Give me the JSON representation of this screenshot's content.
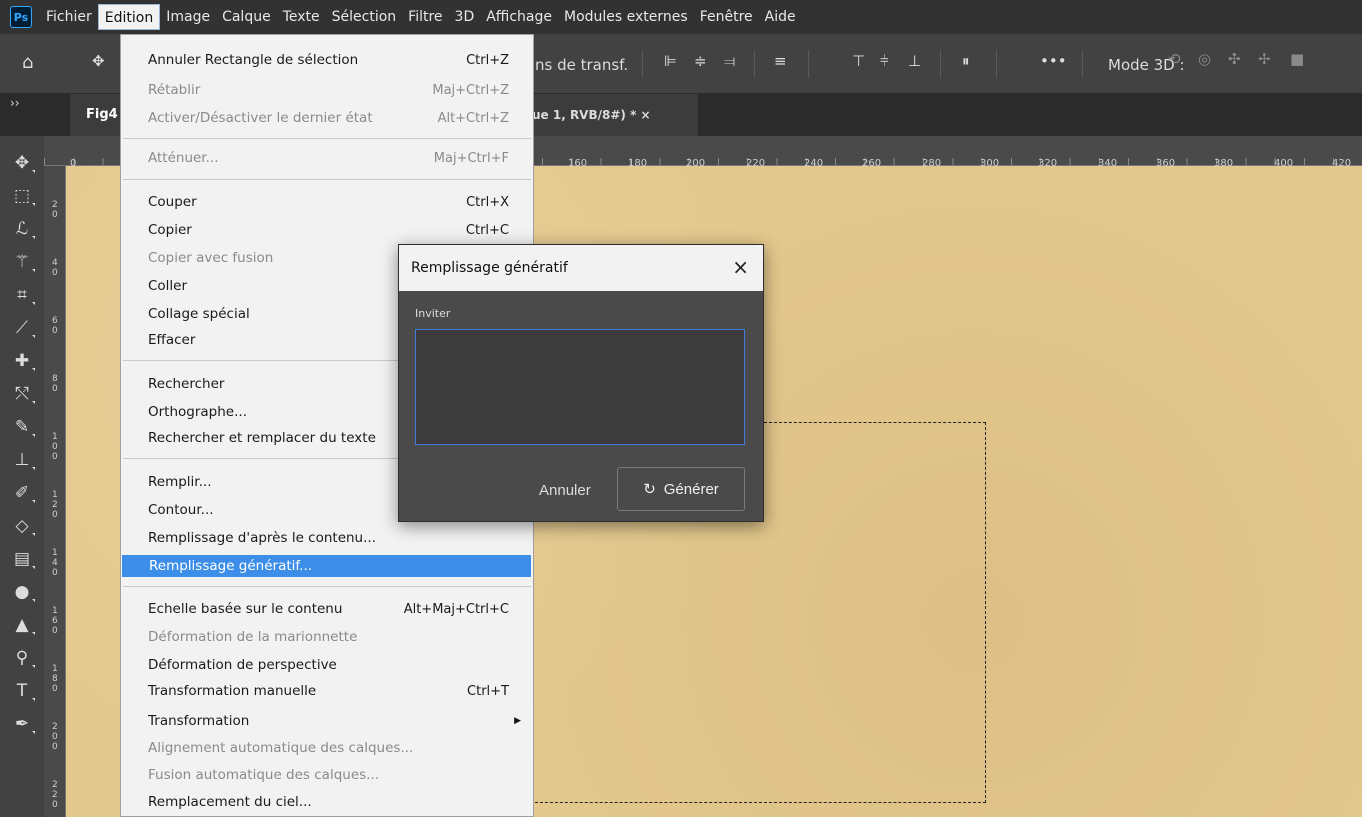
{
  "menubar": {
    "logo": "Ps",
    "items": [
      "Fichier",
      "Edition",
      "Image",
      "Calque",
      "Texte",
      "Sélection",
      "Filtre",
      "3D",
      "Affichage",
      "Modules externes",
      "Fenêtre",
      "Aide"
    ],
    "active": "Edition"
  },
  "options": {
    "transf_label": "ns de transf.",
    "more": "•••",
    "mode3d": "Mode 3D :"
  },
  "tabs": {
    "left": "Fig4",
    "right": "ue 1, RVB/8#) * ×"
  },
  "ruler": {
    "top": [
      "0",
      "160",
      "180",
      "200",
      "220",
      "240",
      "260",
      "280",
      "300",
      "320",
      "340",
      "360",
      "380",
      "400",
      "420"
    ],
    "left": [
      "2 0",
      "4 0",
      "6 0",
      "8 0",
      "1 0 0",
      "1 2 0",
      "1 4 0",
      "1 6 0",
      "1 8 0",
      "2 0 0",
      "2 2 0"
    ]
  },
  "edit_menu": [
    {
      "label": "Annuler Rectangle de sélection",
      "shortcut": "Ctrl+Z",
      "disabled": false
    },
    {
      "label": "Rétablir",
      "shortcut": "Maj+Ctrl+Z",
      "disabled": true
    },
    {
      "label": "Activer/Désactiver le dernier état",
      "shortcut": "Alt+Ctrl+Z",
      "disabled": true
    },
    {
      "label": "Atténuer...",
      "shortcut": "Maj+Ctrl+F",
      "disabled": true
    },
    {
      "label": "Couper",
      "shortcut": "Ctrl+X",
      "disabled": false
    },
    {
      "label": "Copier",
      "shortcut": "Ctrl+C",
      "disabled": false
    },
    {
      "label": "Copier avec fusion",
      "shortcut": "",
      "disabled": true
    },
    {
      "label": "Coller",
      "shortcut": "",
      "disabled": false
    },
    {
      "label": "Collage spécial",
      "shortcut": "",
      "disabled": false
    },
    {
      "label": "Effacer",
      "shortcut": "",
      "disabled": false
    },
    {
      "label": "Rechercher",
      "shortcut": "",
      "disabled": false
    },
    {
      "label": "Orthographe...",
      "shortcut": "",
      "disabled": false
    },
    {
      "label": "Rechercher et remplacer du texte",
      "shortcut": "",
      "disabled": false
    },
    {
      "label": "Remplir...",
      "shortcut": "",
      "disabled": false
    },
    {
      "label": "Contour...",
      "shortcut": "",
      "disabled": false
    },
    {
      "label": "Remplissage d'après le contenu...",
      "shortcut": "",
      "disabled": false
    },
    {
      "label": "Remplissage génératif...",
      "shortcut": "",
      "disabled": false,
      "highlighted": true
    },
    {
      "label": "Echelle basée sur le contenu",
      "shortcut": "Alt+Maj+Ctrl+C",
      "disabled": false
    },
    {
      "label": "Déformation de la marionnette",
      "shortcut": "",
      "disabled": true
    },
    {
      "label": "Déformation de perspective",
      "shortcut": "",
      "disabled": false
    },
    {
      "label": "Transformation manuelle",
      "shortcut": "Ctrl+T",
      "disabled": false
    },
    {
      "label": "Transformation",
      "shortcut": "",
      "disabled": false,
      "submenu": true
    },
    {
      "label": "Alignement automatique des calques...",
      "shortcut": "",
      "disabled": true
    },
    {
      "label": "Fusion automatique des calques...",
      "shortcut": "",
      "disabled": true
    },
    {
      "label": "Remplacement du ciel...",
      "shortcut": "",
      "disabled": false
    }
  ],
  "dialog": {
    "title": "Remplissage génératif",
    "close": "×",
    "prompt_label": "Inviter",
    "prompt_value": "",
    "cancel": "Annuler",
    "generate": "Générer"
  },
  "colors": {
    "canvas": "#e4c98e",
    "highlight": "#3d8ee8",
    "input_border": "#3d7bd6"
  }
}
